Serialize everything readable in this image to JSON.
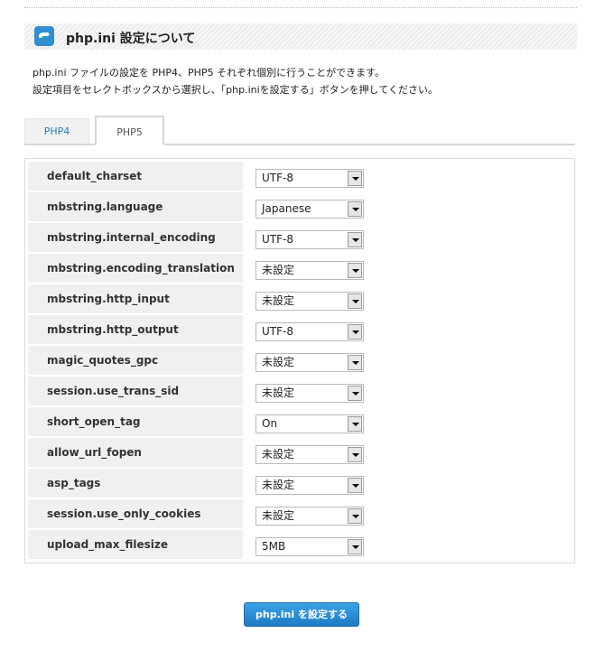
{
  "header": {
    "title": "php.ini 設定について",
    "icon": "php-settings-icon"
  },
  "description": {
    "line1": "php.ini ファイルの設定を PHP4、PHP5 それぞれ個別に行うことができます。",
    "line2": "設定項目をセレクトボックスから選択し、「php.iniを設定する」ボタンを押してください。"
  },
  "tabs": {
    "php4": "PHP4",
    "php5": "PHP5",
    "active": "PHP5"
  },
  "settings": [
    {
      "label": "default_charset",
      "value": "UTF-8"
    },
    {
      "label": "mbstring.language",
      "value": "Japanese"
    },
    {
      "label": "mbstring.internal_encoding",
      "value": "UTF-8"
    },
    {
      "label": "mbstring.encoding_translation",
      "value": "未設定"
    },
    {
      "label": "mbstring.http_input",
      "value": "未設定"
    },
    {
      "label": "mbstring.http_output",
      "value": "UTF-8"
    },
    {
      "label": "magic_quotes_gpc",
      "value": "未設定"
    },
    {
      "label": "session.use_trans_sid",
      "value": "未設定"
    },
    {
      "label": "short_open_tag",
      "value": "On"
    },
    {
      "label": "allow_url_fopen",
      "value": "未設定"
    },
    {
      "label": "asp_tags",
      "value": "未設定"
    },
    {
      "label": "session.use_only_cookies",
      "value": "未設定"
    },
    {
      "label": "upload_max_filesize",
      "value": "5MB"
    }
  ],
  "submit": {
    "label": "php.ini を設定する"
  },
  "colors": {
    "accent": "#2f8fd0",
    "tab_inactive_text": "#2a7fb8",
    "button_top": "#3aa2e6",
    "button_bottom": "#1e7cc4"
  }
}
